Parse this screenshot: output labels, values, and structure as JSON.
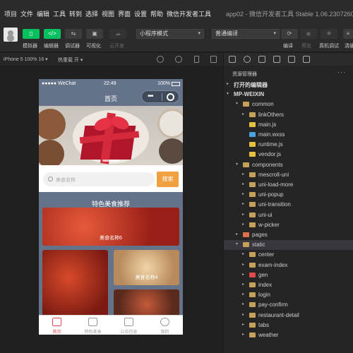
{
  "menubar": {
    "items": [
      "项目",
      "文件",
      "编辑",
      "工具",
      "转到",
      "选择",
      "视图",
      "界面",
      "设置",
      "帮助",
      "微信开发者工具"
    ],
    "app_title": "app02 - 微信开发者工具 Stable 1.06.2307260"
  },
  "toolbar": {
    "simulator_label": "模拟器",
    "editor_label": "编辑器",
    "debugger_label": "调试器",
    "visualize_label": "可视化",
    "cloud_label": "云开发",
    "mode_select": "小程序模式",
    "compile_select": "普通编译",
    "compile_label": "编译",
    "preview_label": "预览",
    "remote_debug_label": "真机调试",
    "clear_cache_label": "清缓"
  },
  "simbar": {
    "device": "iPhone 5 100% 16 ▾",
    "hot_reload": "热重载 开 ▾"
  },
  "phone": {
    "status": {
      "carrier": "●●●●● WeChat",
      "time": "22:49",
      "battery": "100%"
    },
    "nav_title": "首页",
    "search_placeholder": "美食名称",
    "search_button": "搜索",
    "section_title": "特色美食推荐",
    "cards": [
      {
        "label": "美食名称6",
        "color": "#c0392b"
      },
      {
        "label": "",
        "color": "#b03226"
      },
      {
        "label": "美食名称4",
        "color": "#d9b48a"
      },
      {
        "label": "",
        "color": "#8a3a2a"
      }
    ],
    "tabs": [
      {
        "label": "首页",
        "icon": "home-icon",
        "active": true
      },
      {
        "label": "特色美食",
        "icon": "grid-icon",
        "active": false
      },
      {
        "label": "公告信息",
        "icon": "news-icon",
        "active": false
      },
      {
        "label": "我的",
        "icon": "user-icon",
        "active": false
      }
    ]
  },
  "explorer": {
    "title": "资源管理器",
    "more": "···",
    "rows": [
      {
        "name": "打开的编辑器",
        "indent": 0,
        "type": "section",
        "open": false
      },
      {
        "name": "MP-WEIXIN",
        "indent": 0,
        "type": "section",
        "open": true
      },
      {
        "name": "common",
        "indent": 1,
        "type": "folder",
        "open": true
      },
      {
        "name": "linkOthers",
        "indent": 2,
        "type": "folder",
        "open": false
      },
      {
        "name": "main.js",
        "indent": 2,
        "type": "js"
      },
      {
        "name": "main.wxss",
        "indent": 2,
        "type": "wxss"
      },
      {
        "name": "runtime.js",
        "indent": 2,
        "type": "js"
      },
      {
        "name": "vendor.js",
        "indent": 2,
        "type": "js"
      },
      {
        "name": "components",
        "indent": 1,
        "type": "folder",
        "open": true
      },
      {
        "name": "mescroll-uni",
        "indent": 2,
        "type": "folder",
        "open": false
      },
      {
        "name": "uni-load-more",
        "indent": 2,
        "type": "folder",
        "open": false
      },
      {
        "name": "uni-popup",
        "indent": 2,
        "type": "folder",
        "open": false
      },
      {
        "name": "uni-transition",
        "indent": 2,
        "type": "folder",
        "open": false
      },
      {
        "name": "uni-ui",
        "indent": 2,
        "type": "folder",
        "open": false
      },
      {
        "name": "w-picker",
        "indent": 2,
        "type": "folder",
        "open": false
      },
      {
        "name": "pages",
        "indent": 1,
        "type": "pages",
        "open": false
      },
      {
        "name": "static",
        "indent": 1,
        "type": "folder",
        "open": true,
        "selected": true
      },
      {
        "name": "center",
        "indent": 2,
        "type": "folder",
        "open": false
      },
      {
        "name": "exam-index",
        "indent": 2,
        "type": "folder",
        "open": false
      },
      {
        "name": "gen",
        "indent": 2,
        "type": "gen",
        "open": false
      },
      {
        "name": "index",
        "indent": 2,
        "type": "folder",
        "open": false
      },
      {
        "name": "login",
        "indent": 2,
        "type": "folder",
        "open": false
      },
      {
        "name": "pay-confirm",
        "indent": 2,
        "type": "folder",
        "open": false
      },
      {
        "name": "restaurant-detail",
        "indent": 2,
        "type": "folder",
        "open": false
      },
      {
        "name": "tabs",
        "indent": 2,
        "type": "folder",
        "open": false
      },
      {
        "name": "weather",
        "indent": 2,
        "type": "folder",
        "open": false
      }
    ]
  },
  "colors": {
    "accent_green": "#07c160",
    "nav_bg": "#64738a",
    "search_button": "#f0a040",
    "tab_active": "#e04a4a"
  }
}
